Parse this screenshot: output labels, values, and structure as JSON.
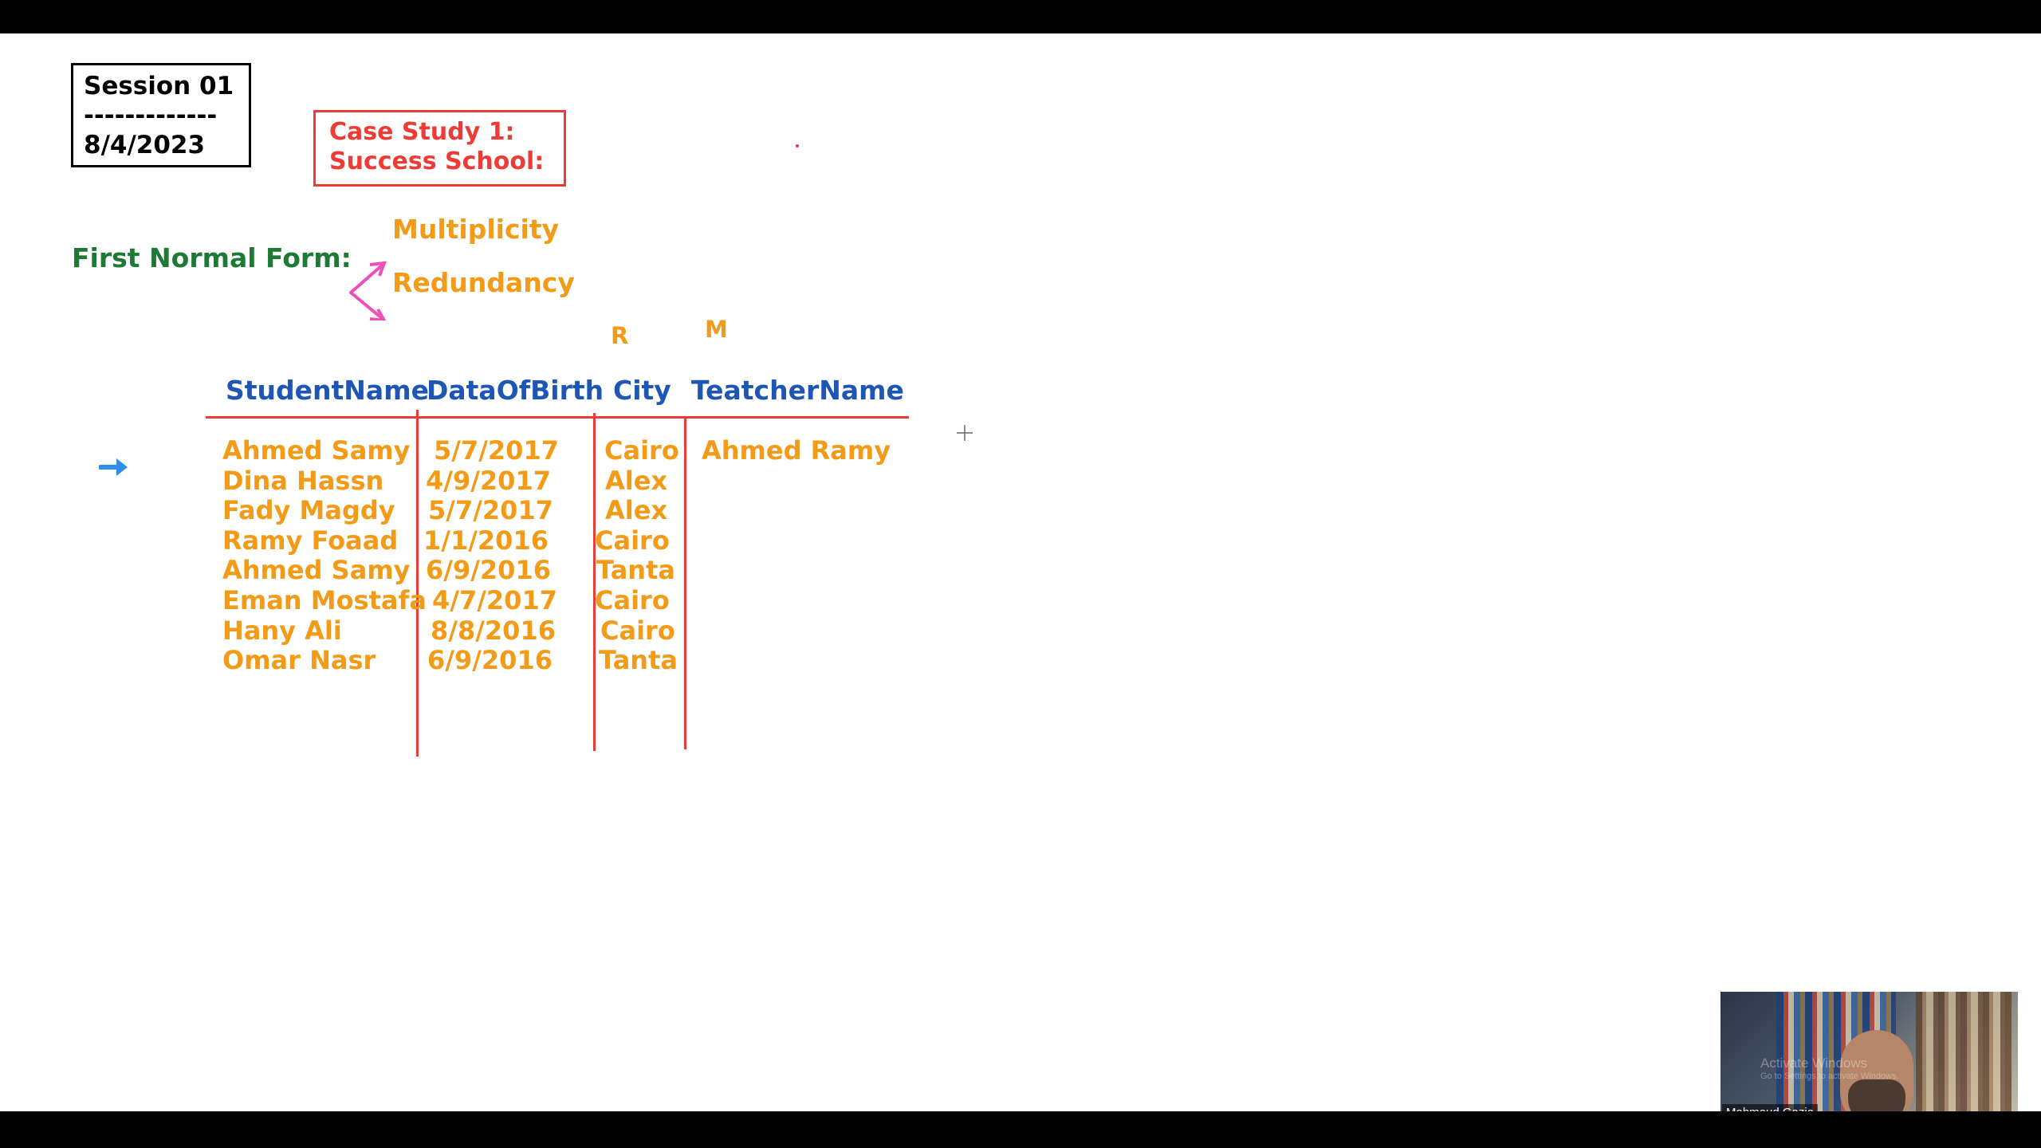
{
  "session": {
    "title": "Session 01",
    "divider": "-------------",
    "date": "8/4/2023"
  },
  "case_study": {
    "line1": "Case Study 1:",
    "line2": "Success School:"
  },
  "first_normal_form": {
    "label": "First Normal Form:",
    "branch_1": "Multiplicity",
    "branch_2": "Redundancy"
  },
  "column_marks": {
    "city": "R",
    "teacher": "M"
  },
  "table": {
    "headers": [
      "StudentName",
      "DataOfBirth",
      "City",
      "TeatcherName"
    ],
    "rows": [
      [
        "Ahmed Samy",
        "5/7/2017",
        "Cairo",
        "Ahmed Ramy"
      ],
      [
        "Dina Hassn",
        "4/9/2017",
        "Alex",
        ""
      ],
      [
        "Fady Magdy",
        "5/7/2017",
        "Alex",
        ""
      ],
      [
        "Ramy Foaad",
        "1/1/2016",
        "Cairo",
        ""
      ],
      [
        "Ahmed Samy",
        "6/9/2016",
        "Tanta",
        ""
      ],
      [
        "Eman Mostafa",
        "4/7/2017",
        "Cairo",
        ""
      ],
      [
        "Hany Ali",
        "8/8/2016",
        "Cairo",
        ""
      ],
      [
        "Omar Nasr",
        "6/9/2016",
        "Tanta",
        ""
      ]
    ]
  },
  "icons": {
    "row_pointer": "arrow-right-icon",
    "cursor": "crosshair-cursor-icon",
    "brace": "fork-arrows-icon"
  },
  "colors": {
    "orange": "#f39a16",
    "blue": "#1e56b5",
    "green": "#1d7a34",
    "red": "#ef3b36",
    "pink": "#f04fb8",
    "arrow_blue": "#2f8fe8"
  },
  "video": {
    "participant_name": "Mahmoud Gazia",
    "watermark_line1": "Activate Windows",
    "watermark_line2": "Go to Settings to activate Windows."
  }
}
